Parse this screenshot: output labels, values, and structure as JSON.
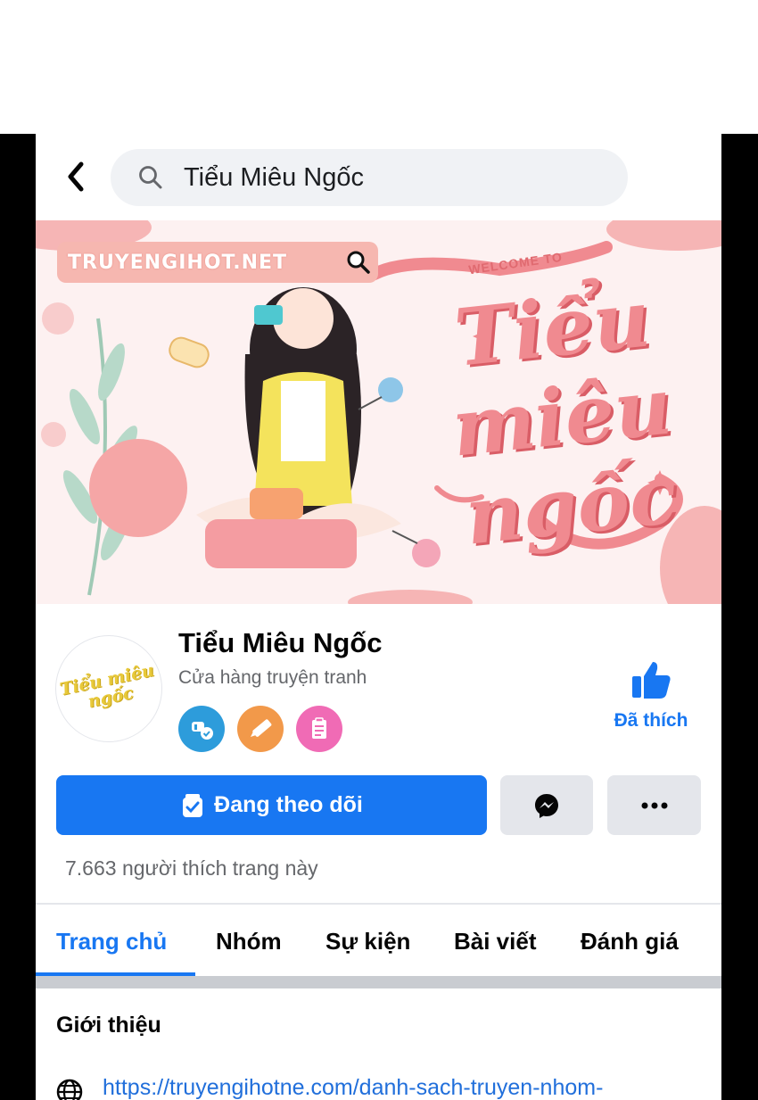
{
  "header": {
    "search_text": "Tiểu Miêu Ngốc"
  },
  "cover": {
    "site_badge": "TRUYENGIHOT.NET",
    "welcome": "WELCOME TO",
    "title_line1": "Tiểu",
    "title_line2": "miêu",
    "title_line3": "ngốc"
  },
  "page": {
    "name": "Tiểu Miêu Ngốc",
    "category": "Cửa hàng truyện tranh",
    "avatar_text": "Tiểu miêu ngốc",
    "liked_label": "Đã thích",
    "badges": [
      "like-badge-icon",
      "pencil-badge-icon",
      "clipboard-badge-icon"
    ]
  },
  "actions": {
    "follow_label": "Đang theo dõi",
    "likes_text": "7.663 người thích trang này"
  },
  "tabs": [
    {
      "label": "Trang chủ",
      "active": true
    },
    {
      "label": "Nhóm",
      "active": false
    },
    {
      "label": "Sự kiện",
      "active": false
    },
    {
      "label": "Bài viết",
      "active": false
    },
    {
      "label": "Đánh giá",
      "active": false
    }
  ],
  "intro": {
    "title": "Giới thiệu",
    "link": "https://truyengihotne.com/danh-sach-truyen-nhom-"
  },
  "colors": {
    "accent": "#1877f2",
    "cover_pink": "#f08a90",
    "secondary_text": "#65676b"
  }
}
